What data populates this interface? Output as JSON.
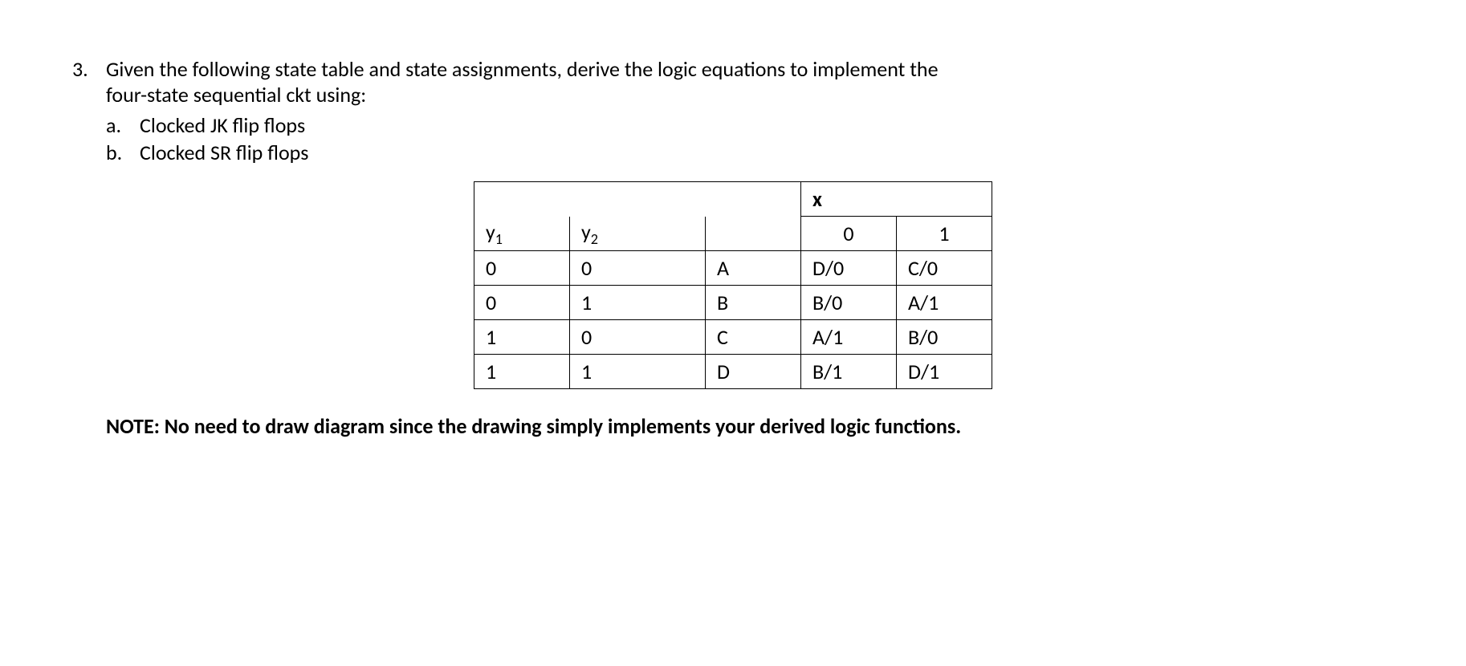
{
  "question": {
    "number": "3.",
    "prompt_line1": "Given the following state table and state assignments, derive the logic equations to implement the",
    "prompt_line2": "four-state sequential ckt using:",
    "subs": [
      {
        "letter": "a.",
        "text": "Clocked JK flip flops"
      },
      {
        "letter": "b.",
        "text": "Clocked SR flip flops"
      }
    ]
  },
  "table": {
    "x_label": "x",
    "y1_label_base": "y",
    "y1_label_sub": "1",
    "y2_label_base": "y",
    "y2_label_sub": "2",
    "x0_label": "0",
    "x1_label": "1",
    "rows": [
      {
        "y1": "0",
        "y2": "0",
        "name": "A",
        "x0": "D/0",
        "x1": "C/0"
      },
      {
        "y1": "0",
        "y2": "1",
        "name": "B",
        "x0": "B/0",
        "x1": "A/1"
      },
      {
        "y1": "1",
        "y2": "0",
        "name": "C",
        "x0": "A/1",
        "x1": "B/0"
      },
      {
        "y1": "1",
        "y2": "1",
        "name": "D",
        "x0": "B/1",
        "x1": "D/1"
      }
    ]
  },
  "note": "NOTE: No need to draw diagram since the drawing simply implements your derived logic functions.",
  "chart_data": {
    "type": "table",
    "description": "State transition table for a four-state sequential circuit",
    "state_encoding": {
      "A": {
        "y1": 0,
        "y2": 0
      },
      "B": {
        "y1": 0,
        "y2": 1
      },
      "C": {
        "y1": 1,
        "y2": 0
      },
      "D": {
        "y1": 1,
        "y2": 1
      }
    },
    "transitions": [
      {
        "present": "A",
        "input_x": 0,
        "next": "D",
        "output": 0
      },
      {
        "present": "A",
        "input_x": 1,
        "next": "C",
        "output": 0
      },
      {
        "present": "B",
        "input_x": 0,
        "next": "B",
        "output": 0
      },
      {
        "present": "B",
        "input_x": 1,
        "next": "A",
        "output": 1
      },
      {
        "present": "C",
        "input_x": 0,
        "next": "A",
        "output": 1
      },
      {
        "present": "C",
        "input_x": 1,
        "next": "B",
        "output": 0
      },
      {
        "present": "D",
        "input_x": 0,
        "next": "B",
        "output": 1
      },
      {
        "present": "D",
        "input_x": 1,
        "next": "D",
        "output": 1
      }
    ]
  }
}
